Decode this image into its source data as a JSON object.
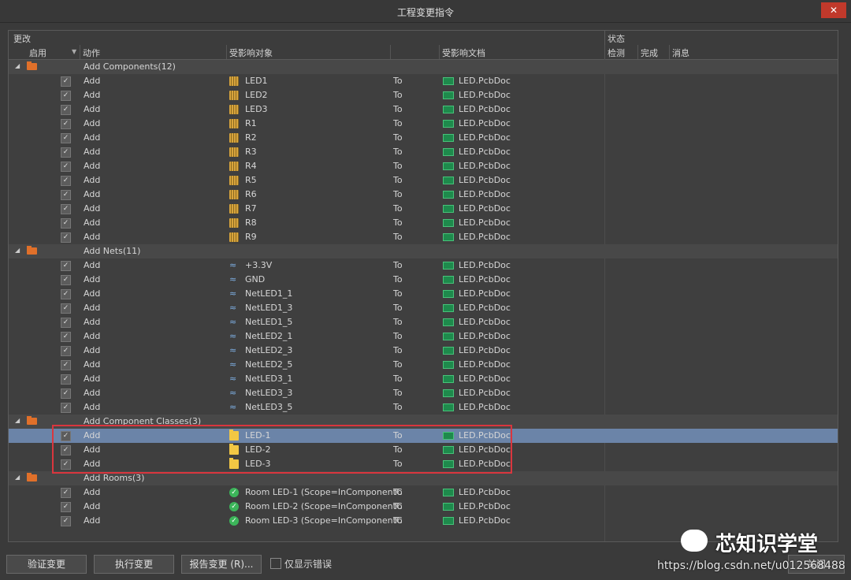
{
  "window": {
    "title": "工程变更指令",
    "close_glyph": "✕"
  },
  "header": {
    "group_changes": "更改",
    "group_status": "状态",
    "col_enable": "启用",
    "col_action": "动作",
    "col_affected_object": "受影响对象",
    "col_affected_doc": "受影响文档",
    "col_check": "检测",
    "col_done": "完成",
    "col_message": "消息"
  },
  "groups": [
    {
      "label": "Add Components(12)",
      "icon": "folder-icon",
      "rows": [
        {
          "action": "Add",
          "object": "LED1",
          "to": "To",
          "doc": "LED.PcbDoc",
          "icon": "component-icon"
        },
        {
          "action": "Add",
          "object": "LED2",
          "to": "To",
          "doc": "LED.PcbDoc",
          "icon": "component-icon"
        },
        {
          "action": "Add",
          "object": "LED3",
          "to": "To",
          "doc": "LED.PcbDoc",
          "icon": "component-icon"
        },
        {
          "action": "Add",
          "object": "R1",
          "to": "To",
          "doc": "LED.PcbDoc",
          "icon": "component-icon"
        },
        {
          "action": "Add",
          "object": "R2",
          "to": "To",
          "doc": "LED.PcbDoc",
          "icon": "component-icon"
        },
        {
          "action": "Add",
          "object": "R3",
          "to": "To",
          "doc": "LED.PcbDoc",
          "icon": "component-icon"
        },
        {
          "action": "Add",
          "object": "R4",
          "to": "To",
          "doc": "LED.PcbDoc",
          "icon": "component-icon"
        },
        {
          "action": "Add",
          "object": "R5",
          "to": "To",
          "doc": "LED.PcbDoc",
          "icon": "component-icon"
        },
        {
          "action": "Add",
          "object": "R6",
          "to": "To",
          "doc": "LED.PcbDoc",
          "icon": "component-icon"
        },
        {
          "action": "Add",
          "object": "R7",
          "to": "To",
          "doc": "LED.PcbDoc",
          "icon": "component-icon"
        },
        {
          "action": "Add",
          "object": "R8",
          "to": "To",
          "doc": "LED.PcbDoc",
          "icon": "component-icon"
        },
        {
          "action": "Add",
          "object": "R9",
          "to": "To",
          "doc": "LED.PcbDoc",
          "icon": "component-icon"
        }
      ]
    },
    {
      "label": "Add Nets(11)",
      "icon": "folder-icon",
      "rows": [
        {
          "action": "Add",
          "object": "+3.3V",
          "to": "To",
          "doc": "LED.PcbDoc",
          "icon": "net-icon"
        },
        {
          "action": "Add",
          "object": "GND",
          "to": "To",
          "doc": "LED.PcbDoc",
          "icon": "net-icon"
        },
        {
          "action": "Add",
          "object": "NetLED1_1",
          "to": "To",
          "doc": "LED.PcbDoc",
          "icon": "net-icon"
        },
        {
          "action": "Add",
          "object": "NetLED1_3",
          "to": "To",
          "doc": "LED.PcbDoc",
          "icon": "net-icon"
        },
        {
          "action": "Add",
          "object": "NetLED1_5",
          "to": "To",
          "doc": "LED.PcbDoc",
          "icon": "net-icon"
        },
        {
          "action": "Add",
          "object": "NetLED2_1",
          "to": "To",
          "doc": "LED.PcbDoc",
          "icon": "net-icon"
        },
        {
          "action": "Add",
          "object": "NetLED2_3",
          "to": "To",
          "doc": "LED.PcbDoc",
          "icon": "net-icon"
        },
        {
          "action": "Add",
          "object": "NetLED2_5",
          "to": "To",
          "doc": "LED.PcbDoc",
          "icon": "net-icon"
        },
        {
          "action": "Add",
          "object": "NetLED3_1",
          "to": "To",
          "doc": "LED.PcbDoc",
          "icon": "net-icon"
        },
        {
          "action": "Add",
          "object": "NetLED3_3",
          "to": "To",
          "doc": "LED.PcbDoc",
          "icon": "net-icon"
        },
        {
          "action": "Add",
          "object": "NetLED3_5",
          "to": "To",
          "doc": "LED.PcbDoc",
          "icon": "net-icon"
        }
      ]
    },
    {
      "label": "Add Component Classes(3)",
      "icon": "folder-icon",
      "rows": [
        {
          "action": "Add",
          "object": "LED-1",
          "to": "To",
          "doc": "LED.PcbDoc",
          "icon": "class-folder-icon",
          "selected": true
        },
        {
          "action": "Add",
          "object": "LED-2",
          "to": "To",
          "doc": "LED.PcbDoc",
          "icon": "class-folder-icon"
        },
        {
          "action": "Add",
          "object": "LED-3",
          "to": "To",
          "doc": "LED.PcbDoc",
          "icon": "class-folder-icon"
        }
      ]
    },
    {
      "label": "Add Rooms(3)",
      "icon": "folder-icon",
      "rows": [
        {
          "action": "Add",
          "object": "Room LED-1 (Scope=InComponentC",
          "to": "To",
          "doc": "LED.PcbDoc",
          "icon": "room-icon"
        },
        {
          "action": "Add",
          "object": "Room LED-2 (Scope=InComponentC",
          "to": "To",
          "doc": "LED.PcbDoc",
          "icon": "room-icon"
        },
        {
          "action": "Add",
          "object": "Room LED-3 (Scope=InComponentC",
          "to": "To",
          "doc": "LED.PcbDoc",
          "icon": "room-icon"
        }
      ]
    }
  ],
  "footer": {
    "validate_label": "验证变更",
    "execute_label": "执行变更",
    "report_label": "报告变更 (R)...",
    "only_errors_label": "仅显示错误",
    "close_label": "关闭"
  },
  "watermark": {
    "text": "芯知识学堂",
    "url": "https://blog.csdn.net/u012568488"
  }
}
